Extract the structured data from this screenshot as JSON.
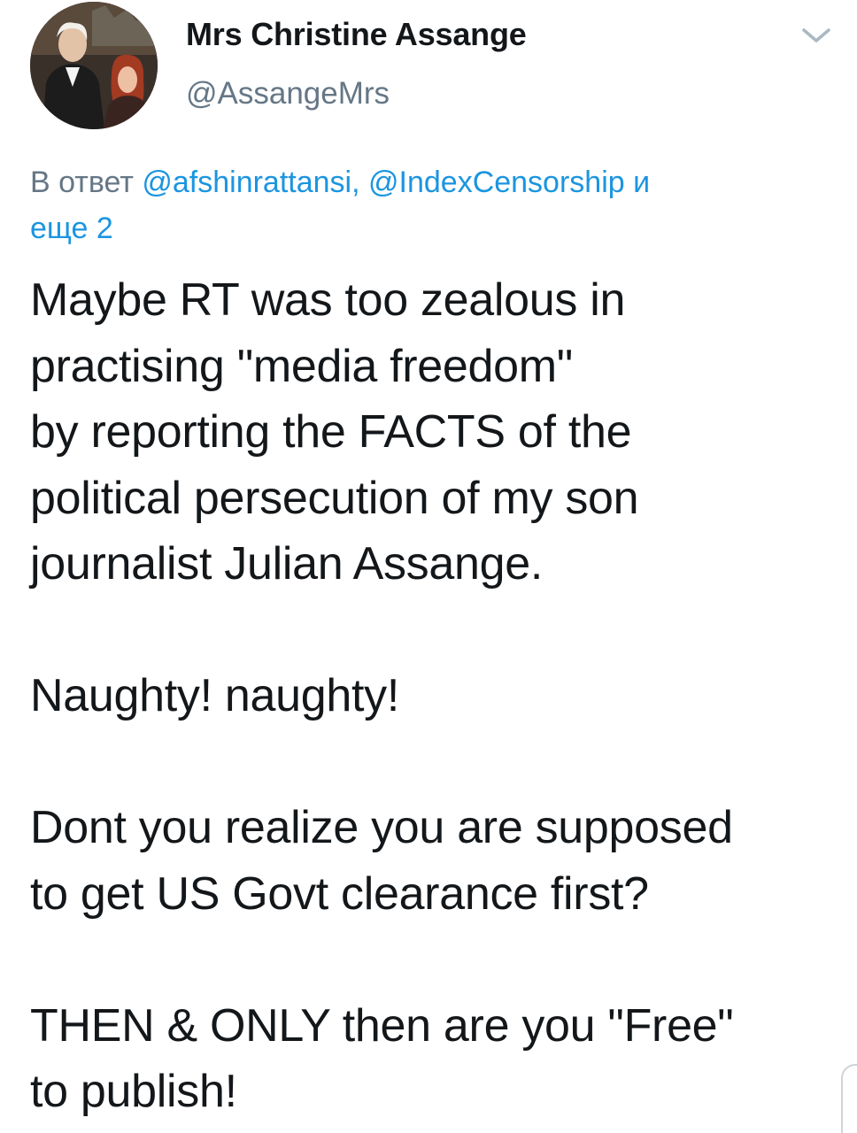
{
  "author": {
    "name": "Mrs Christine Assange",
    "handle": "@AssangeMrs"
  },
  "reply": {
    "prefix": "В ответ",
    "mention1": "@afshinrattansi,",
    "mention2": "@IndexCensorship",
    "conjunction": "и",
    "more": "еще 2"
  },
  "tweet": {
    "lines1": "Maybe RT was too zealous in\npractising \"media freedom\"\nby reporting the FACTS of the\npolitical persecution of my son\njournalist Julian Assange.",
    "line2": "Naughty! naughty!",
    "lines3": "Dont you realize you are supposed\nto get US Govt clearance first?",
    "lines4": "THEN  & ONLY then are you \"Free\"\nto publish!"
  },
  "icons": {
    "menu": "chevron-down-icon"
  },
  "colors": {
    "link": "#1b95e0",
    "muted": "#657786",
    "text": "#14171a"
  }
}
